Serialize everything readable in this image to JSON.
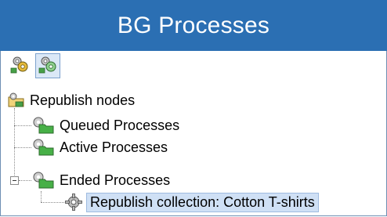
{
  "window": {
    "title": "BG Processes"
  },
  "toolbar": {
    "buttons": [
      "process-group-icon",
      "process-group-active-icon"
    ]
  },
  "tree": {
    "root": {
      "label": "Republish nodes",
      "icon": "folder-process-icon"
    },
    "children": [
      {
        "label": "Queued Processes",
        "icon": "gears-folder-icon"
      },
      {
        "label": "Active Processes",
        "icon": "gears-folder-icon"
      },
      {
        "label": "Ended Processes",
        "icon": "gears-folder-icon",
        "expanded": true,
        "children": [
          {
            "label": "Republish collection: Cotton T-shirts",
            "icon": "gear-icon",
            "selected": true
          }
        ]
      }
    ]
  },
  "colors": {
    "title_bar": "#2b6fb3",
    "selection": "#cfe0f5"
  }
}
